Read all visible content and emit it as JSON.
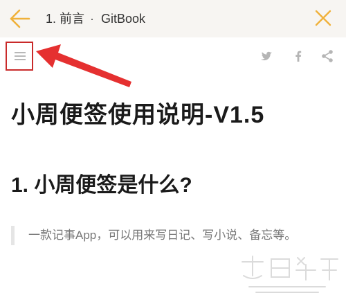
{
  "header": {
    "chapter": "1. 前言",
    "separator": "·",
    "book": "GitBook",
    "back_icon": "arrow-left-icon",
    "close_icon": "close-icon"
  },
  "toolbar": {
    "menu_icon": "hamburger-menu-icon",
    "share": [
      "twitter-icon",
      "facebook-icon",
      "share-icon"
    ]
  },
  "content": {
    "title": "小周便签使用说明-V1.5",
    "section_heading": "1. 小周便签是什么?",
    "quote": "一款记事App，可以用来写日记、写小说、备忘等。"
  },
  "colors": {
    "accent": "#f0b13a",
    "annotation": "#c92a2a",
    "header_bg": "#f7f5f2",
    "icon_gray": "#b5b5b5"
  }
}
